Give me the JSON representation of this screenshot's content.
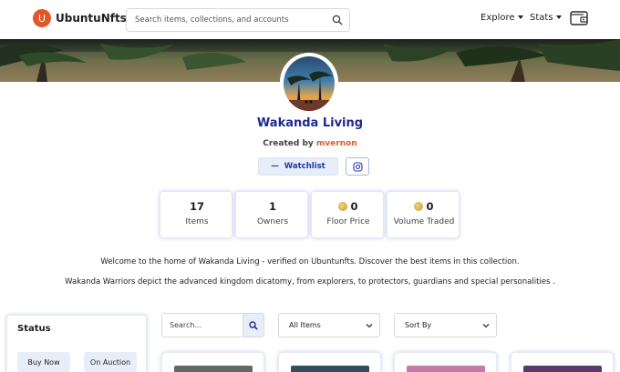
{
  "header": {
    "logo_letter": "U",
    "brand": "UbuntuNfts",
    "search_placeholder": "Search items, collections, and accounts",
    "nav": [
      "Explore",
      "Stats"
    ]
  },
  "collection": {
    "title": "Wakanda Living",
    "created_by_label": "Created by",
    "creator": "mvernon",
    "watchlist_label": "Watchlist"
  },
  "stats": [
    {
      "value": "17",
      "label": "Items",
      "coin": false
    },
    {
      "value": "1",
      "label": "Owners",
      "coin": false
    },
    {
      "value": "0",
      "label": "Floor Price",
      "coin": true
    },
    {
      "value": "0",
      "label": "Volume Traded",
      "coin": true
    }
  ],
  "description": [
    "Welcome to the home of Wakanda Living - verified on Ubuntunfts. Discover the best items in this collection.",
    "Wakanda Warriors depict the advanced kingdom dicatomy, from explorers, to protectors, guardians and special personalities ."
  ],
  "filters": {
    "status_title": "Status",
    "buttons": [
      "Buy Now",
      "On Auction"
    ],
    "search_placeholder": "Search...",
    "items_select": "All Items",
    "sort_select": "Sort By"
  },
  "colors": {
    "brand_orange": "#e0582a",
    "title_blue": "#1e2a8c",
    "button_bg": "#e8eef9"
  }
}
